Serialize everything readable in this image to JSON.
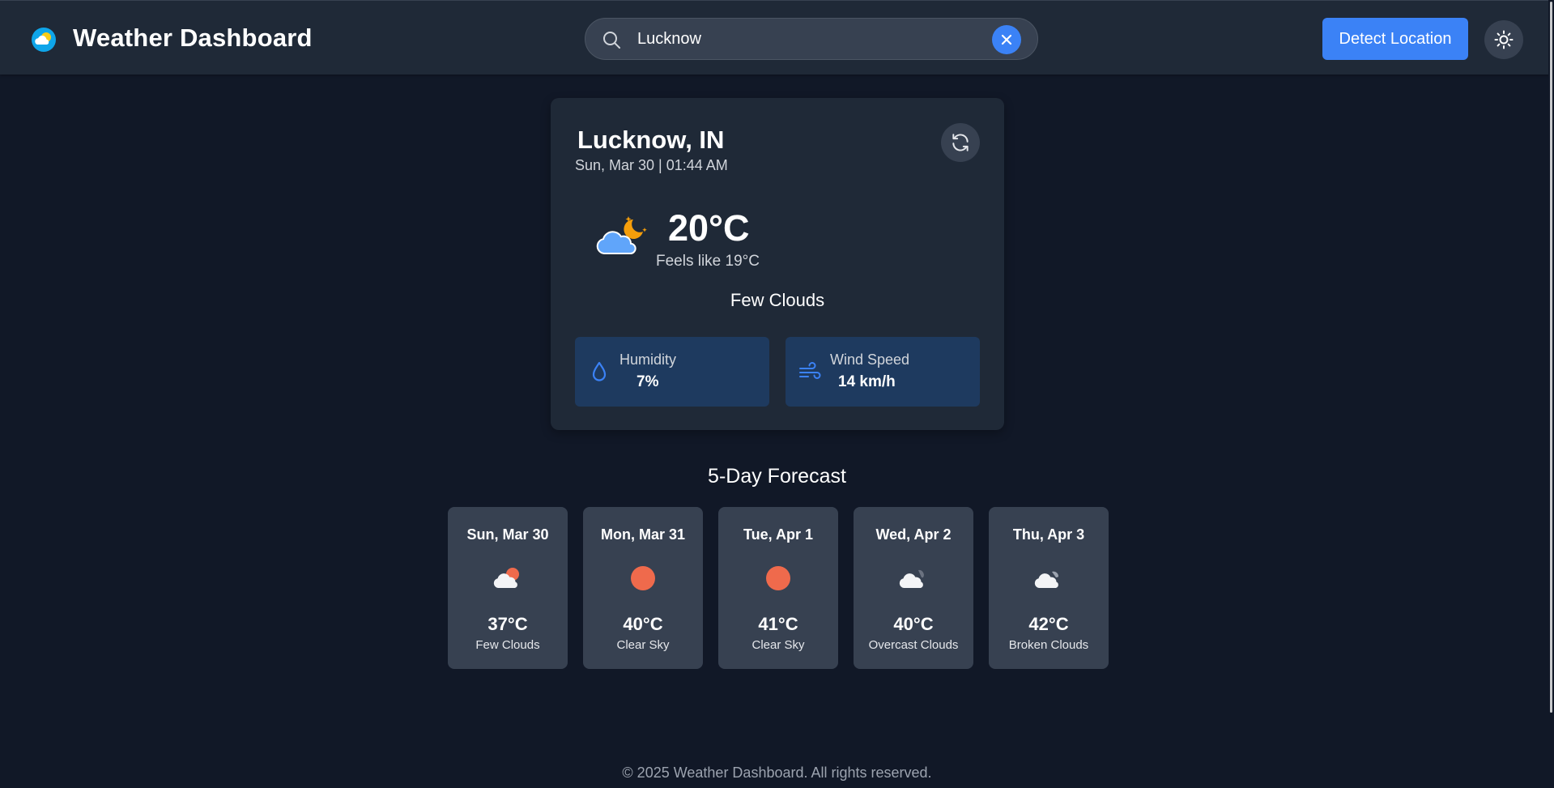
{
  "header": {
    "title": "Weather Dashboard",
    "search_value": "Lucknow",
    "detect_label": "Detect Location"
  },
  "current": {
    "city": "Lucknow, IN",
    "datetime": "Sun, Mar 30 | 01:44 AM",
    "icon": "few-clouds-night-icon",
    "temperature": "20°C",
    "feels_like": "Feels like 19°C",
    "condition": "Few Clouds",
    "humidity_label": "Humidity",
    "humidity_value": "7%",
    "wind_label": "Wind Speed",
    "wind_value": "14 km/h"
  },
  "forecast": {
    "title": "5-Day Forecast",
    "days": [
      {
        "day": "Sun, Mar 30",
        "temp": "37°C",
        "desc": "Few Clouds",
        "icon": "few-clouds-day-icon"
      },
      {
        "day": "Mon, Mar 31",
        "temp": "40°C",
        "desc": "Clear Sky",
        "icon": "sun-icon"
      },
      {
        "day": "Tue, Apr 1",
        "temp": "41°C",
        "desc": "Clear Sky",
        "icon": "sun-icon"
      },
      {
        "day": "Wed, Apr 2",
        "temp": "40°C",
        "desc": "Overcast Clouds",
        "icon": "overcast-clouds-icon"
      },
      {
        "day": "Thu, Apr 3",
        "temp": "42°C",
        "desc": "Broken Clouds",
        "icon": "broken-clouds-icon"
      }
    ]
  },
  "footer": {
    "text": "© 2025 Weather Dashboard. All rights reserved."
  },
  "colors": {
    "background": "#111827",
    "header": "#1f2937",
    "card": "#1f2937",
    "accent": "#3b82f6",
    "stat_box": "#1e3a5f",
    "forecast_card": "#374151"
  }
}
